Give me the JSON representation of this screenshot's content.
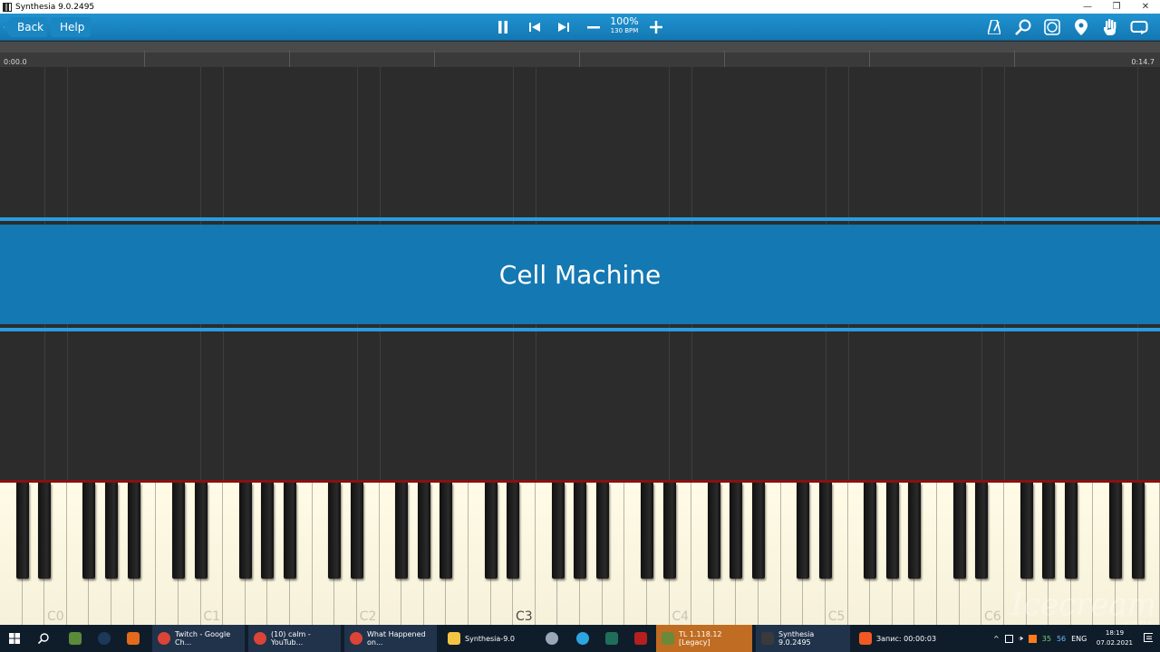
{
  "window": {
    "title": "Synthesia 9.0.2495",
    "buttons": [
      "—",
      "❐",
      "✕"
    ]
  },
  "toolbar": {
    "back_label": "Back",
    "help_label": "Help",
    "speed_percent": "100%",
    "tempo": "130 BPM",
    "icons": [
      "pause-icon",
      "previous-icon",
      "next-icon",
      "minus-icon",
      "plus-icon",
      "metronome-icon",
      "magnifier-icon",
      "learning-icon",
      "location-pin-icon",
      "hand-icon",
      "loop-icon"
    ]
  },
  "timeline": {
    "start": "0:00.0",
    "end": "0:14.7"
  },
  "song": {
    "title": "Cell Machine"
  },
  "keyboard": {
    "octave_labels": [
      "C0",
      "C1",
      "C2",
      "C3",
      "C4",
      "C5",
      "C6"
    ],
    "highlighted_label": "C3"
  },
  "watermark": {
    "brand": "Icecream",
    "sub": "APPS"
  },
  "taskbar": {
    "items": [
      {
        "label": "Twitch - Google Ch...",
        "color": "#db4437"
      },
      {
        "label": "(10) calm - YouTub...",
        "color": "#db4437"
      },
      {
        "label": "What Happened on...",
        "color": "#db4437"
      },
      {
        "label": "Synthesia-9.0",
        "color": "#f4c542"
      },
      {
        "label": "TL 1.118.12 [Legacy]",
        "color": "#6a8a3a"
      },
      {
        "label": "Synthesia 9.0.2495",
        "color": "#3a3a3a"
      },
      {
        "label": "Запис: 00:00:03",
        "color": "#f05a22"
      }
    ],
    "tray": {
      "lang": "ENG",
      "num1": "35",
      "num2": "56"
    },
    "clock": {
      "time": "18:19",
      "date": "07.02.2021"
    }
  }
}
